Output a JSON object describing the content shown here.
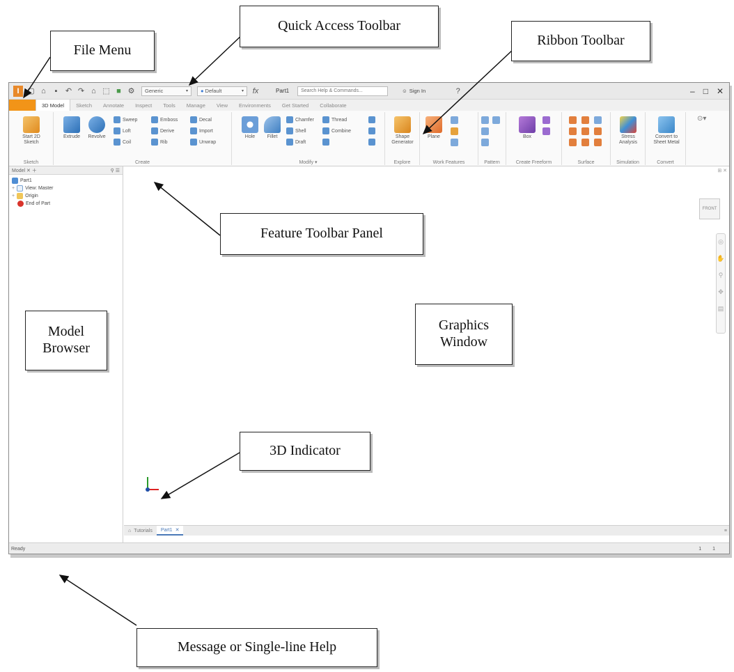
{
  "callouts": {
    "file_menu": "File Menu",
    "quick_access": "Quick Access Toolbar",
    "ribbon": "Ribbon Toolbar",
    "feature_panel": "Feature Toolbar Panel",
    "model_browser": "Model Browser",
    "graphics_window": "Graphics Window",
    "indicator_3d": "3D Indicator",
    "message_help": "Message or Single-line Help"
  },
  "titlebar": {
    "material": "Generic",
    "appearance": "Default",
    "fx": "fx",
    "document": "Part1",
    "search_placeholder": "Search Help & Commands...",
    "signin": "Sign In"
  },
  "tabs": [
    "3D Model",
    "Sketch",
    "Annotate",
    "Inspect",
    "Tools",
    "Manage",
    "View",
    "Environments",
    "Get Started",
    "Collaborate"
  ],
  "ribbon": {
    "start_sketch": "Start 2D Sketch",
    "extrude": "Extrude",
    "revolve": "Revolve",
    "sweep": "Sweep",
    "emboss": "Emboss",
    "decal": "Decal",
    "loft": "Loft",
    "derive": "Derive",
    "import": "Import",
    "coil": "Coil",
    "rib": "Rib",
    "unwrap": "Unwrap",
    "hole": "Hole",
    "fillet": "Fillet",
    "chamfer": "Chamfer",
    "thread": "Thread",
    "shell": "Shell",
    "combine": "Combine",
    "draft": "Draft",
    "shape_generator": "Shape Generator",
    "plane": "Plane",
    "box": "Box",
    "stress_analysis": "Stress Analysis",
    "convert_sheet_metal": "Convert to Sheet Metal",
    "panels": {
      "sketch": "Sketch",
      "create": "Create",
      "modify": "Modify ▾",
      "explore": "Explore",
      "work_features": "Work Features",
      "pattern": "Pattern",
      "create_freeform": "Create Freeform",
      "surface": "Surface",
      "simulation": "Simulation",
      "convert": "Convert"
    }
  },
  "browser": {
    "header": "Model",
    "items": [
      "Part1",
      "View: Master",
      "Origin",
      "End of Part"
    ]
  },
  "viewcube_label": "FRONT",
  "doc_tabs": {
    "home": "Tutorials",
    "part": "Part1"
  },
  "status": {
    "text": "Ready",
    "right_a": "1",
    "right_b": "1"
  },
  "colors": {
    "file_tab": "#f29418",
    "accent_blue": "#4a79b8"
  }
}
